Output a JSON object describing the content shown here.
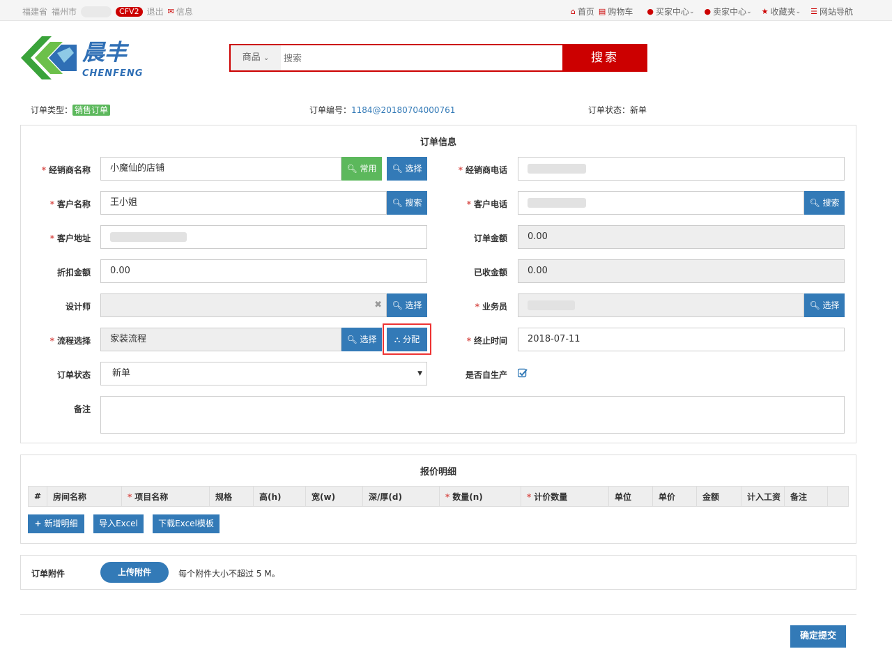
{
  "topbar": {
    "province": "福建省",
    "city": "福州市",
    "badge": "CFV2",
    "logout": "退出",
    "message": "信息",
    "links": [
      "首页",
      "购物车",
      "买家中心",
      "卖家中心",
      "收藏夹",
      "网站导航"
    ]
  },
  "brand": {
    "name_cn": "晨丰",
    "name_en": "CHENFENG"
  },
  "search": {
    "category": "商品",
    "placeholder": "搜索",
    "button": "搜索"
  },
  "order_meta": {
    "type_label": "订单类型：",
    "type_value": "销售订单",
    "no_label": "订单编号：",
    "no_value": "1184@20180704000761",
    "status_label": "订单状态：",
    "status_value": "新单"
  },
  "order_info": {
    "title": "订单信息",
    "dealer_name_label": "经销商名称",
    "dealer_name_value": "小魔仙的店铺",
    "common_btn": "常用",
    "select_btn": "选择",
    "search_btn": "搜索",
    "dealer_phone_label": "经销商电话",
    "customer_name_label": "客户名称",
    "customer_name_value": "王小姐",
    "customer_phone_label": "客户电话",
    "customer_addr_label": "客户地址",
    "order_amount_label": "订单金额",
    "order_amount_value": "0.00",
    "discount_label": "折扣金额",
    "discount_value": "0.00",
    "received_label": "已收金额",
    "received_value": "0.00",
    "designer_label": "设计师",
    "salesman_label": "业务员",
    "process_label": "流程选择",
    "process_value": "家装流程",
    "assign_btn": "分配",
    "end_time_label": "终止时间",
    "end_time_value": "2018-07-11",
    "status_label": "订单状态",
    "status_value": "新单",
    "self_produce_label": "是否自生产",
    "remark_label": "备注"
  },
  "quote": {
    "title": "报价明细",
    "columns": [
      {
        "label": "#",
        "required": false
      },
      {
        "label": "房间名称",
        "required": false
      },
      {
        "label": "项目名称",
        "required": true
      },
      {
        "label": "规格",
        "required": false
      },
      {
        "label": "高(h)",
        "required": false
      },
      {
        "label": "宽(w)",
        "required": false
      },
      {
        "label": "深/厚(d)",
        "required": false
      },
      {
        "label": "数量(n)",
        "required": true
      },
      {
        "label": "计价数量",
        "required": true
      },
      {
        "label": "单位",
        "required": false
      },
      {
        "label": "单价",
        "required": false
      },
      {
        "label": "金额",
        "required": false
      },
      {
        "label": "计入工资",
        "required": false
      },
      {
        "label": "备注",
        "required": false
      },
      {
        "label": "",
        "required": false
      }
    ],
    "add_btn": "新增明细",
    "import_btn": "导入Excel",
    "download_btn": "下载Excel模板"
  },
  "attachment": {
    "label": "订单附件",
    "upload_btn": "上传附件",
    "hint": "每个附件大小不超过 5 M。"
  },
  "submit_btn": "确定提交",
  "colors": {
    "brand_red": "#cc0000",
    "primary": "#337ab7",
    "success": "#5cb85c",
    "highlight": "#ee3333"
  }
}
